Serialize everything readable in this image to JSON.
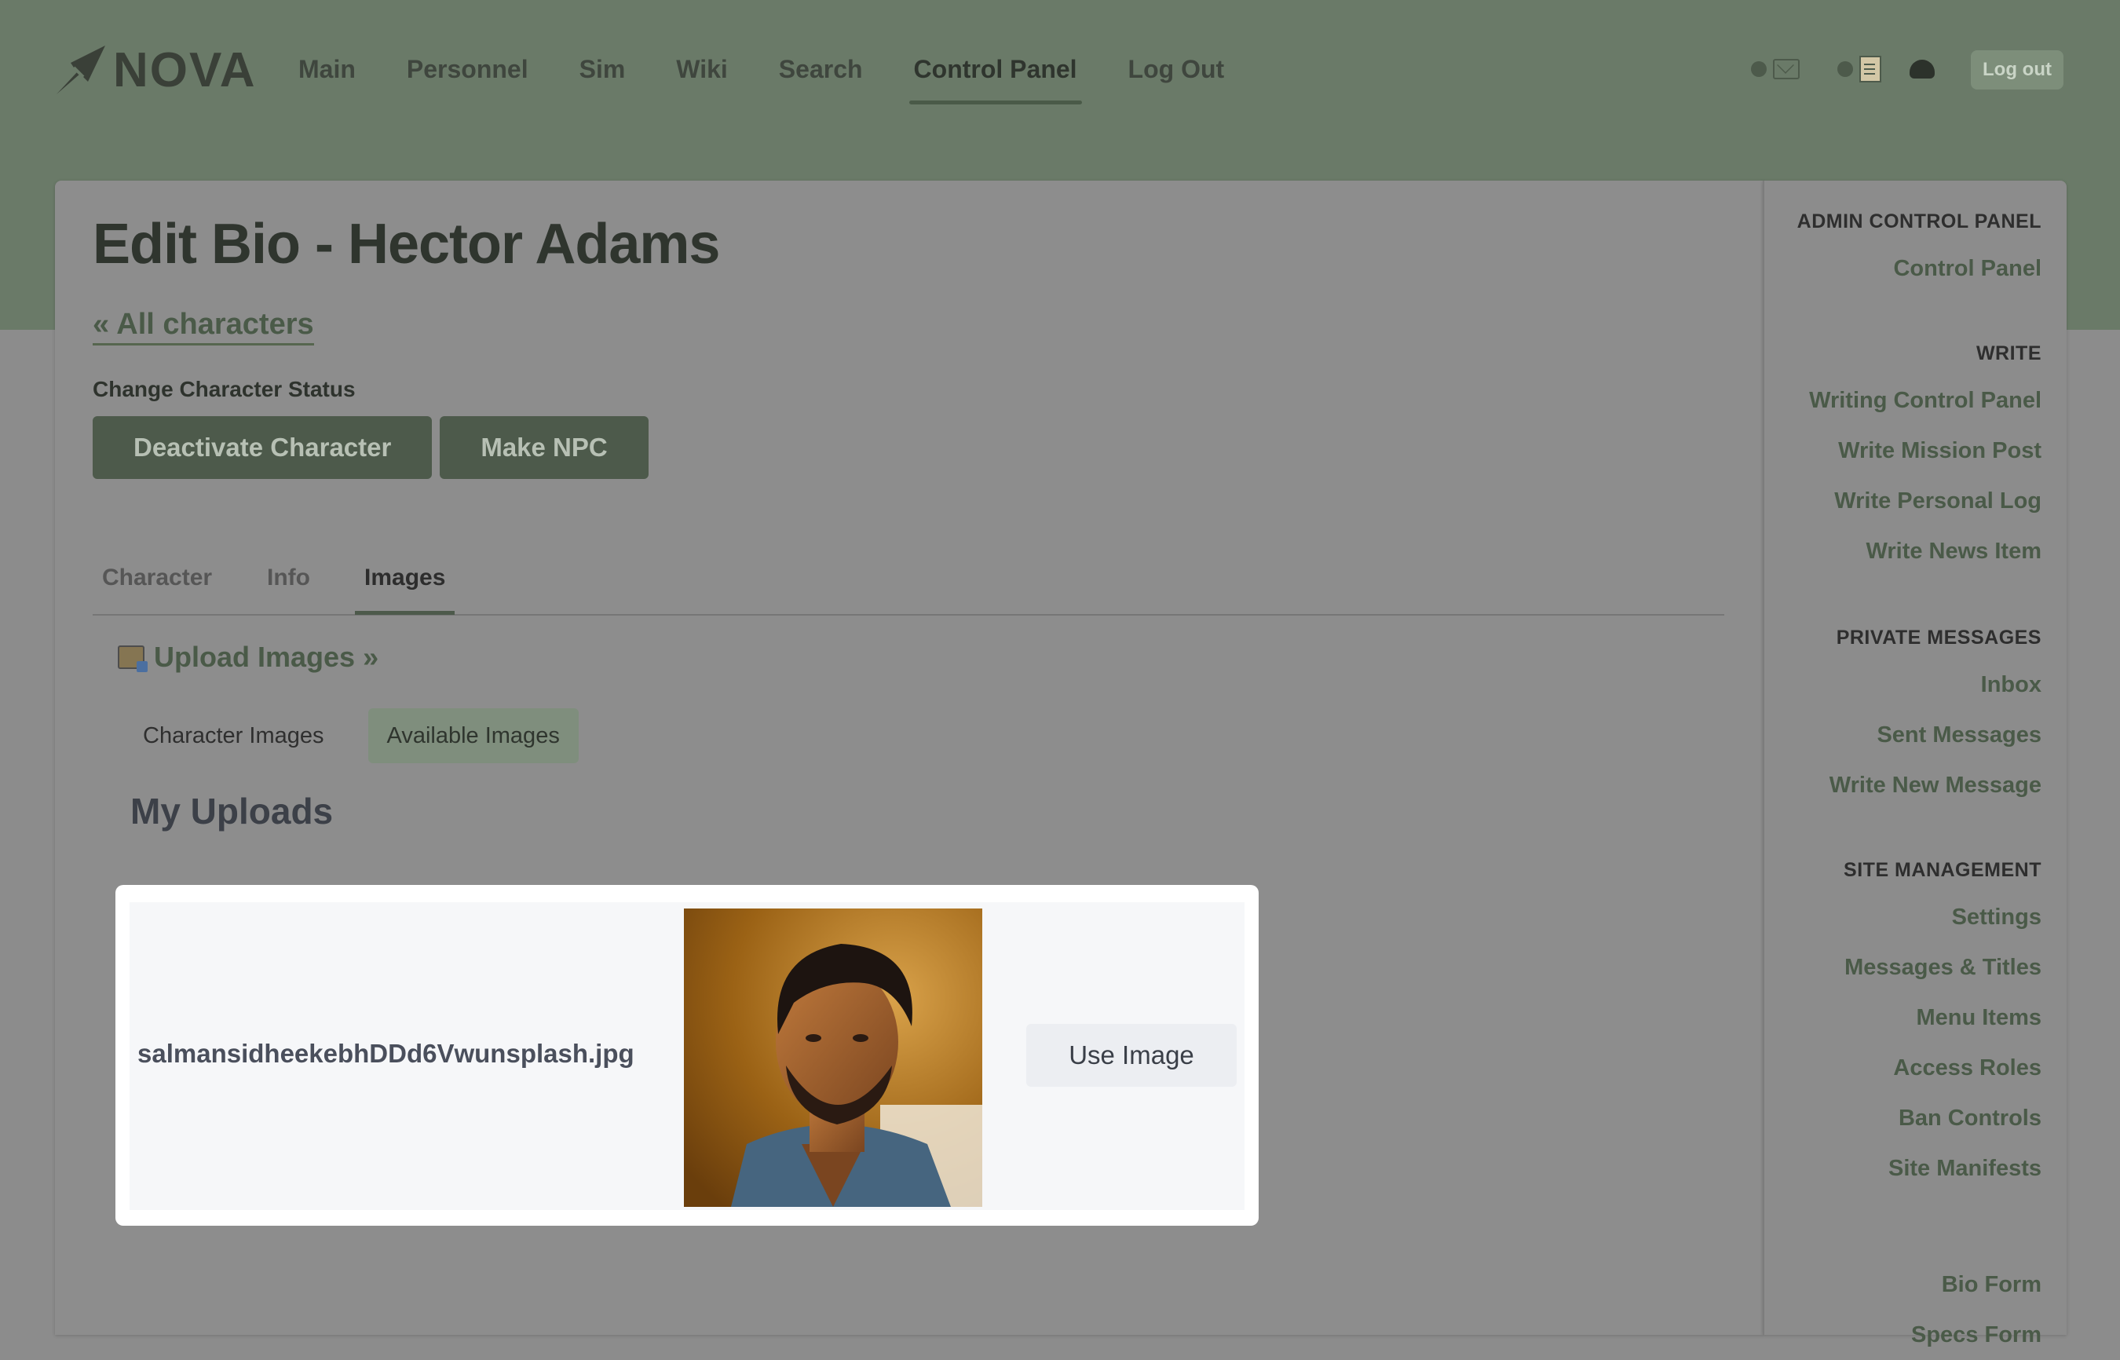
{
  "brand": {
    "name": "NOVA"
  },
  "nav": {
    "links": [
      "Main",
      "Personnel",
      "Sim",
      "Wiki",
      "Search",
      "Control Panel",
      "Log Out"
    ],
    "active": "Control Panel",
    "logout_button": "Log out"
  },
  "page": {
    "title": "Edit Bio - Hector Adams",
    "back_link": "« All characters",
    "status_label": "Change Character Status",
    "status_buttons": [
      "Deactivate Character",
      "Make NPC"
    ],
    "tabs": [
      "Character",
      "Info",
      "Images"
    ],
    "active_tab": "Images",
    "upload_link": "Upload Images »",
    "subtabs": [
      "Character Images",
      "Available Images"
    ],
    "active_subtab": "Available Images",
    "section_heading": "My Uploads",
    "upload": {
      "filename": "salmansidheekebhDDd6Vwunsplash.jpg",
      "action": "Use Image"
    }
  },
  "sidebar": {
    "sections": [
      {
        "heading": "ADMIN CONTROL PANEL",
        "items": [
          "Control Panel"
        ]
      },
      {
        "heading": "WRITE",
        "items": [
          "Writing Control Panel",
          "Write Mission Post",
          "Write Personal Log",
          "Write News Item"
        ]
      },
      {
        "heading": "PRIVATE MESSAGES",
        "items": [
          "Inbox",
          "Sent Messages",
          "Write New Message"
        ]
      },
      {
        "heading": "SITE MANAGEMENT",
        "items": [
          "Settings",
          "Messages & Titles",
          "Menu Items",
          "Access Roles",
          "Ban Controls",
          "Site Manifests"
        ]
      },
      {
        "heading": "",
        "items": [
          "Bio Form",
          "Specs Form"
        ]
      }
    ]
  },
  "colors": {
    "header_band": "#6a7a68",
    "overlay_gray": "#8c8c8c",
    "accent_green": "#4d5a4b",
    "link_green": "#4a5a48",
    "card_white": "#ffffff"
  }
}
